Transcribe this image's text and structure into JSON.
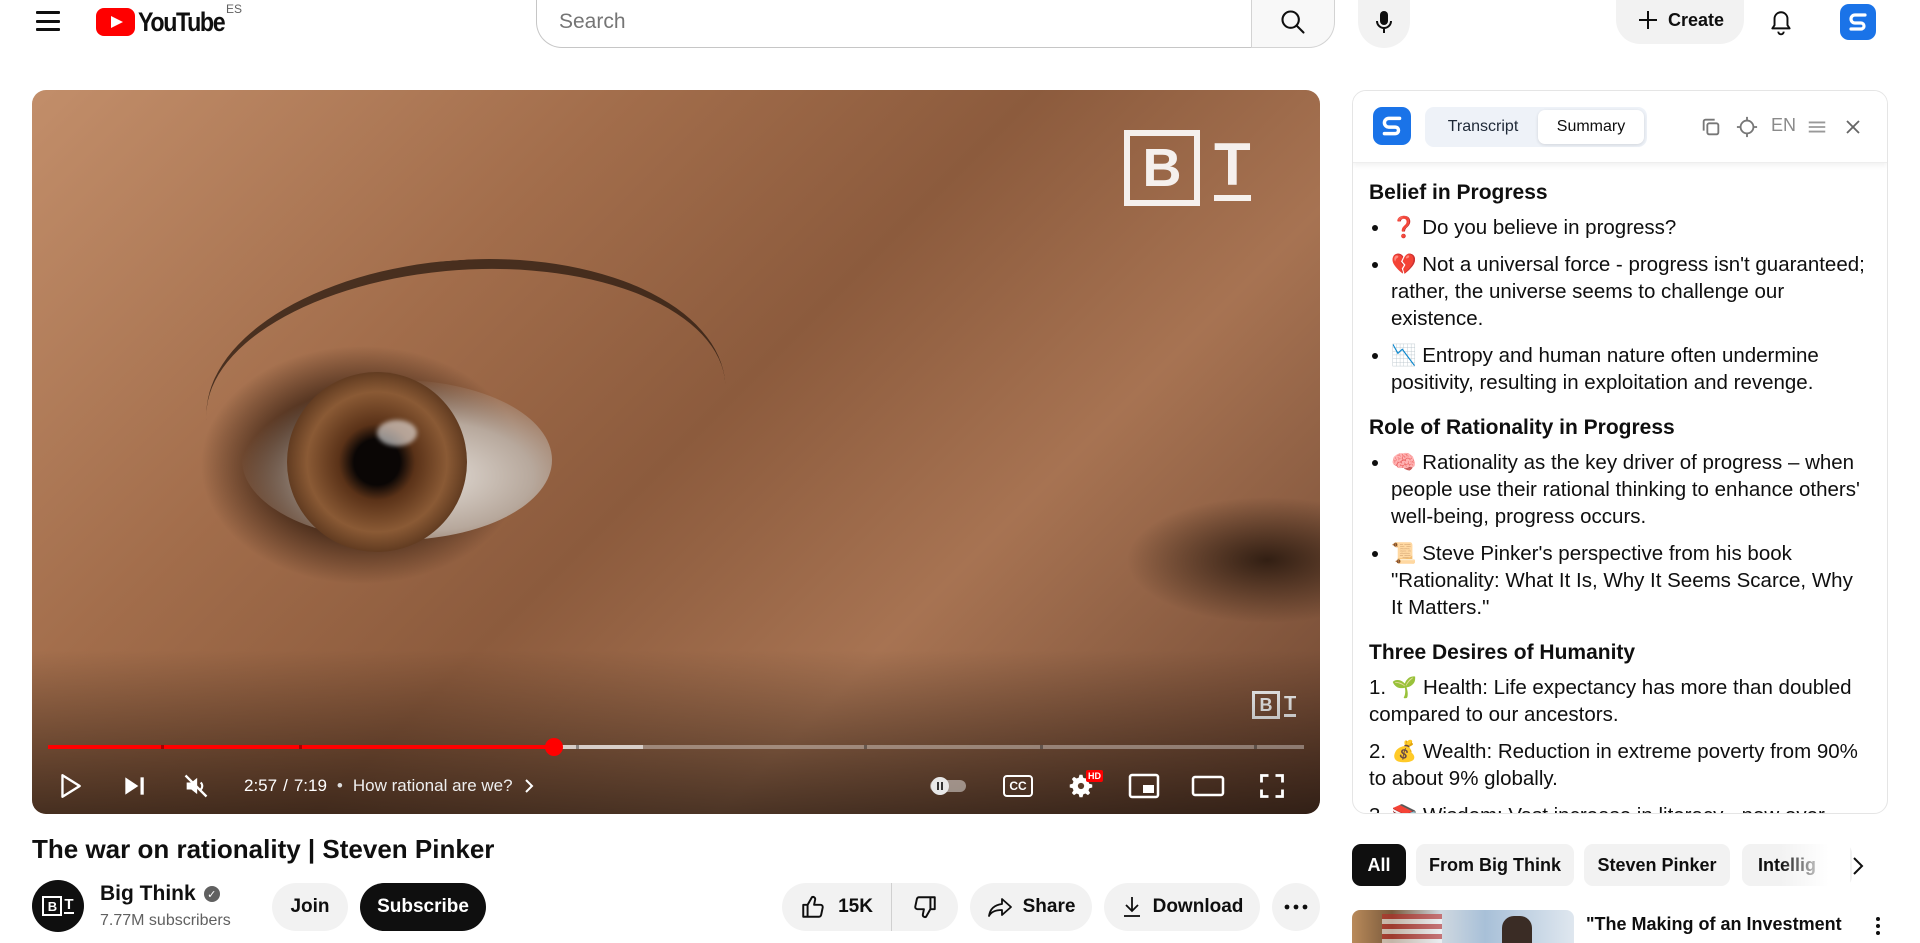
{
  "header": {
    "logo_text": "YouTube",
    "country_code": "ES",
    "search_placeholder": "Search",
    "create_label": "Create"
  },
  "player": {
    "current_time": "2:57",
    "duration": "7:19",
    "time_separator": "/",
    "bullet": "•",
    "chapter": "How rational are we?",
    "progress_fraction": 0.403,
    "buffer_fraction": 0.474,
    "chapter_break_fractions": [
      0.09,
      0.2,
      0.42,
      0.65,
      0.79,
      0.96
    ],
    "hd_badge": "HD",
    "cc_label": "CC",
    "watermark_letter_b": "B",
    "watermark_letter_t": "T",
    "accent_color": "#ff0000"
  },
  "panel": {
    "tabs": [
      "Transcript",
      "Summary"
    ],
    "active_tab": "Summary",
    "language": "EN",
    "sections": [
      {
        "heading": "Belief in Progress",
        "list_type": "bullet",
        "items": [
          "❓ Do you believe in progress?",
          "💔 Not a universal force - progress isn't guaranteed; rather, the universe seems to challenge our existence.",
          "📉 Entropy and human nature often undermine positivity, resulting in exploitation and revenge."
        ]
      },
      {
        "heading": "Role of Rationality in Progress",
        "list_type": "bullet",
        "items": [
          "🧠 Rationality as the key driver of progress – when people use their rational thinking to enhance others' well-being, progress occurs.",
          "📜 Steve Pinker's perspective from his book \"Rationality: What It Is, Why It Seems Scarce, Why It Matters.\""
        ]
      },
      {
        "heading": "Three Desires of Humanity",
        "list_type": "numbered",
        "items": [
          "1. 🌱 Health: Life expectancy has more than doubled compared to our ancestors.",
          "2. 💰 Wealth: Reduction in extreme poverty from 90% to about 9% globally.",
          "3. 📚 Wisdom: Vast increase in literacy - now over"
        ]
      }
    ]
  },
  "video": {
    "title": "The war on rationality | Steven Pinker",
    "channel_name": "Big Think",
    "channel_avatar_b": "B",
    "channel_avatar_t": "T",
    "subscribers": "7.77M subscribers",
    "join_label": "Join",
    "subscribe_label": "Subscribe",
    "likes": "15K",
    "share_label": "Share",
    "download_label": "Download"
  },
  "chips": [
    "All",
    "From Big Think",
    "Steven Pinker",
    "Intellig"
  ],
  "recommendation": {
    "title": "\"The Making of an Investment"
  }
}
